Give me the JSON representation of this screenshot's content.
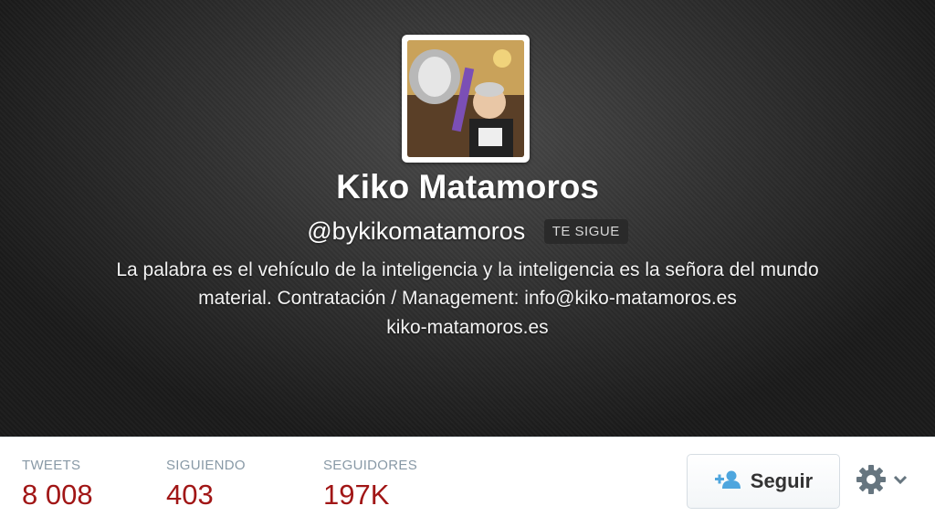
{
  "profile": {
    "name": "Kiko Matamoros",
    "handle": "@bykikomatamoros",
    "follows_you_badge": "TE SIGUE",
    "bio": "La palabra es el vehículo de la inteligencia y la inteligencia es la señora del mundo material. Contratación / Management: info@kiko-matamoros.es",
    "website": "kiko-matamoros.es"
  },
  "stats": [
    {
      "label": "TWEETS",
      "value": "8 008"
    },
    {
      "label": "SIGUIENDO",
      "value": "403"
    },
    {
      "label": "SEGUIDORES",
      "value": "197K"
    }
  ],
  "actions": {
    "follow_label": "Seguir",
    "follow_icon": "add-user-icon",
    "settings_icon": "gear-icon"
  },
  "colors": {
    "stat_value": "#a11616",
    "stat_label": "#8899a6",
    "follow_icon": "#4ea6de"
  }
}
